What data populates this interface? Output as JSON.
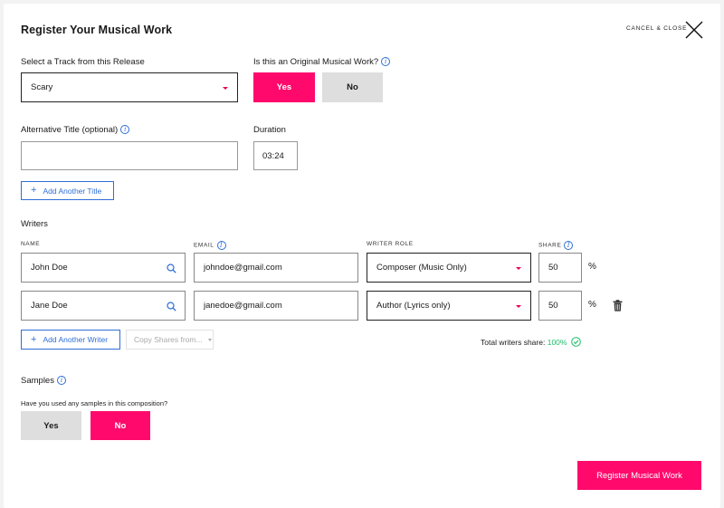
{
  "header": {
    "title": "Register Your Musical Work",
    "cancel_label": "CANCEL & CLOSE"
  },
  "track": {
    "label": "Select a Track from this Release",
    "selected": "Scary"
  },
  "original": {
    "label": "Is this an Original Musical Work?",
    "yes_label": "Yes",
    "no_label": "No",
    "selected": "Yes"
  },
  "alt_title": {
    "label": "Alternative Title (optional)",
    "value": "",
    "add_label": "Add Another Title"
  },
  "duration": {
    "label": "Duration",
    "value": "03:24"
  },
  "writers": {
    "label": "Writers",
    "columns": {
      "name": "NAME",
      "email": "EMAIL",
      "role": "WRITER ROLE",
      "share": "SHARE"
    },
    "rows": [
      {
        "name": "John Doe",
        "email": "johndoe@gmail.com",
        "role": "Composer (Music Only)",
        "share": "50",
        "unit": "%"
      },
      {
        "name": "Jane Doe",
        "email": "janedoe@gmail.com",
        "role": "Author (Lyrics only)",
        "share": "50",
        "unit": "%"
      }
    ],
    "add_label": "Add Another Writer",
    "copy_label": "Copy Shares from...",
    "total_label": "Total writers share:",
    "total_value": "100%"
  },
  "samples": {
    "label": "Samples",
    "question": "Have you used any samples in this composition?",
    "yes_label": "Yes",
    "no_label": "No",
    "selected": "No"
  },
  "submit": {
    "label": "Register Musical Work"
  },
  "colors": {
    "accent": "#ff0a6c",
    "link": "#2f6fd6",
    "success": "#1fbf6a",
    "neutral": "#dedede"
  }
}
